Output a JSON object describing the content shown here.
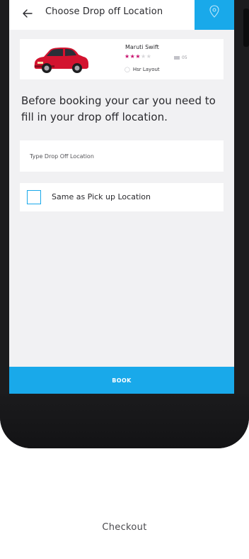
{
  "topbar": {
    "back_icon": "arrow-left-icon",
    "title": "Choose Drop off Location",
    "location_icon": "map-pin-icon",
    "accent_color": "#19a9ea"
  },
  "car": {
    "name": "Maruti Swift",
    "rating": 3,
    "rating_max": 5,
    "seats": "05",
    "location": "Hsr Layout",
    "car_color": "#d3132f",
    "star_color": "#c8116e"
  },
  "message": "Before booking your car you need to fill in your drop off location.",
  "dropoff": {
    "placeholder": "Type Drop Off Location",
    "value": ""
  },
  "same_as_pickup": {
    "label": "Same as Pick up Location",
    "checked": false
  },
  "book_label": "BOOK",
  "caption": "Checkout"
}
